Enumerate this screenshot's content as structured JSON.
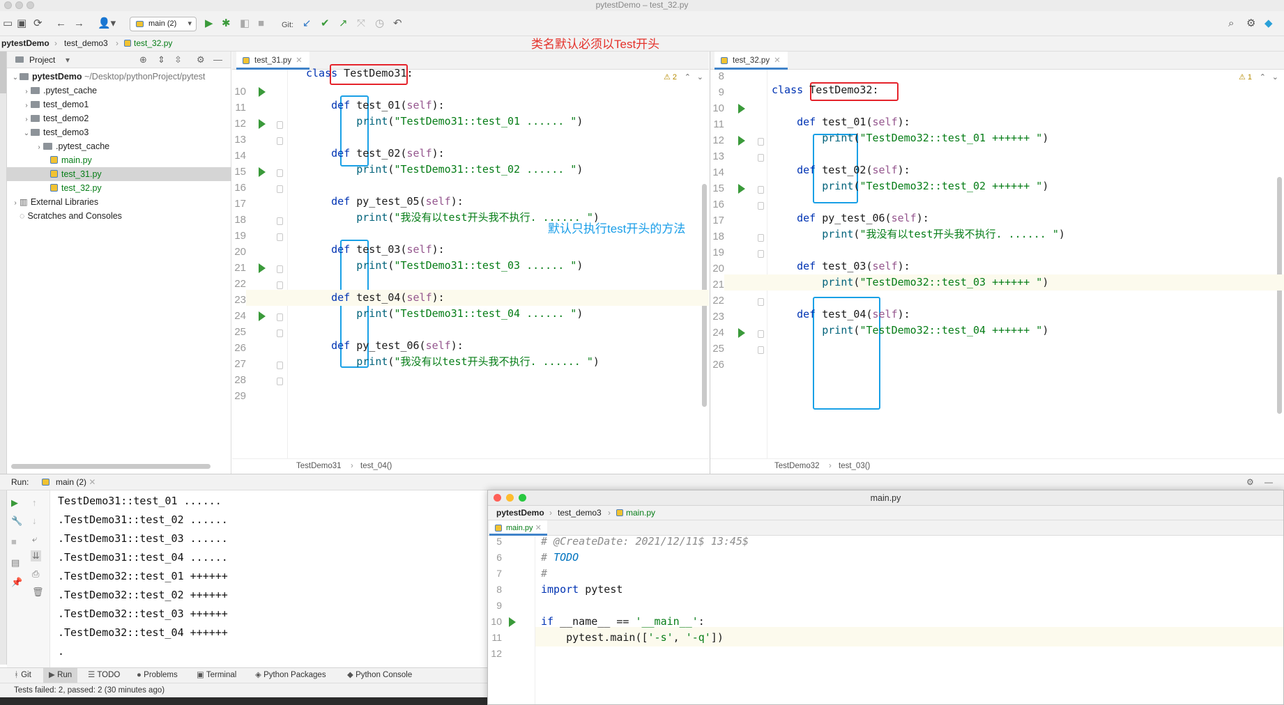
{
  "window": {
    "title": "pytestDemo – test_32.py"
  },
  "toolbar": {
    "run_config": "main (2)",
    "git_label": "Git:"
  },
  "nav": {
    "crumbs": [
      "pytestDemo",
      "test_demo3",
      "test_32.py"
    ]
  },
  "annotations": {
    "top": "类名默认必须以Test开头",
    "middle": "默认只执行test开头的方法"
  },
  "project": {
    "header": "Project",
    "tree": [
      {
        "label": "pytestDemo",
        "extra": "~/Desktop/pythonProject/pytest",
        "kind": "root"
      },
      {
        "label": ".pytest_cache",
        "kind": "folder"
      },
      {
        "label": "test_demo1",
        "kind": "folder"
      },
      {
        "label": "test_demo2",
        "kind": "folder"
      },
      {
        "label": "test_demo3",
        "kind": "folder-open"
      },
      {
        "label": ".pytest_cache",
        "kind": "folder"
      },
      {
        "label": "main.py",
        "kind": "py"
      },
      {
        "label": "test_31.py",
        "kind": "py-selected"
      },
      {
        "label": "test_32.py",
        "kind": "py"
      },
      {
        "label": "External Libraries",
        "kind": "lib"
      },
      {
        "label": "Scratches and Consoles",
        "kind": "scratch"
      }
    ]
  },
  "editor_left": {
    "tab": "test_31.py",
    "warnings": "2",
    "line_numbers": [
      "10",
      "11",
      "12",
      "13",
      "14",
      "15",
      "16",
      "17",
      "18",
      "19",
      "20",
      "21",
      "22",
      "23",
      "24",
      "25",
      "26",
      "27",
      "28",
      "29"
    ],
    "lines": [
      "class TestDemo31:",
      "",
      "    def test_01(self):",
      "        print(\"TestDemo31::test_01 ...... \")",
      "",
      "    def test_02(self):",
      "        print(\"TestDemo31::test_02 ...... \")",
      "",
      "    def py_test_05(self):",
      "        print(\"我没有以test开头我不执行. ...... \")",
      "",
      "    def test_03(self):",
      "        print(\"TestDemo31::test_03 ...... \")",
      "",
      "    def test_04(self):",
      "        print(\"TestDemo31::test_04 ...... \")",
      "",
      "    def py_test_06(self):",
      "        print(\"我没有以test开头我不执行. ...... \")",
      ""
    ],
    "crumbs": [
      "TestDemo31",
      "test_04()"
    ]
  },
  "editor_right": {
    "tab": "test_32.py",
    "warnings": "1",
    "line_numbers": [
      "8",
      "9",
      "10",
      "11",
      "12",
      "13",
      "14",
      "15",
      "16",
      "17",
      "18",
      "19",
      "20",
      "21",
      "22",
      "23",
      "24",
      "25",
      "26"
    ],
    "lines": [
      "",
      "",
      "class TestDemo32:",
      "",
      "    def test_01(self):",
      "        print(\"TestDemo32::test_01 ++++++ \")",
      "",
      "    def test_02(self):",
      "        print(\"TestDemo32::test_02 ++++++ \")",
      "",
      "    def py_test_06(self):",
      "        print(\"我没有以test开头我不执行. ...... \")",
      "",
      "    def test_03(self):",
      "        print(\"TestDemo32::test_03 ++++++ \")",
      "",
      "    def test_04(self):",
      "        print(\"TestDemo32::test_04 ++++++ \")",
      ""
    ],
    "crumbs": [
      "TestDemo32",
      "test_03()"
    ]
  },
  "run": {
    "label": "Run:",
    "tab": "main (2)",
    "output": [
      "TestDemo31::test_01 ......",
      ".TestDemo31::test_02 ......",
      ".TestDemo31::test_03 ......",
      ".TestDemo31::test_04 ......",
      ".TestDemo32::test_01 ++++++",
      ".TestDemo32::test_02 ++++++",
      ".TestDemo32::test_03 ++++++",
      ".TestDemo32::test_04 ++++++",
      "."
    ]
  },
  "main_window": {
    "title": "main.py",
    "crumbs": [
      "pytestDemo",
      "test_demo3",
      "main.py"
    ],
    "tab": "main.py",
    "line_numbers": [
      "5",
      "6",
      "7",
      "8",
      "9",
      "10",
      "11",
      "12"
    ],
    "lines": [
      "# @CreateDate: 2021/12/11$ 13:45$",
      "# TODO",
      "#",
      "import pytest",
      "",
      "if __name__ == '__main__':",
      "    pytest.main(['-s', '-q'])",
      ""
    ]
  },
  "tool_windows": [
    "Git",
    "Run",
    "TODO",
    "Problems",
    "Terminal",
    "Python Packages",
    "Python Console"
  ],
  "status": "Tests failed: 2, passed: 2 (30 minutes ago)"
}
